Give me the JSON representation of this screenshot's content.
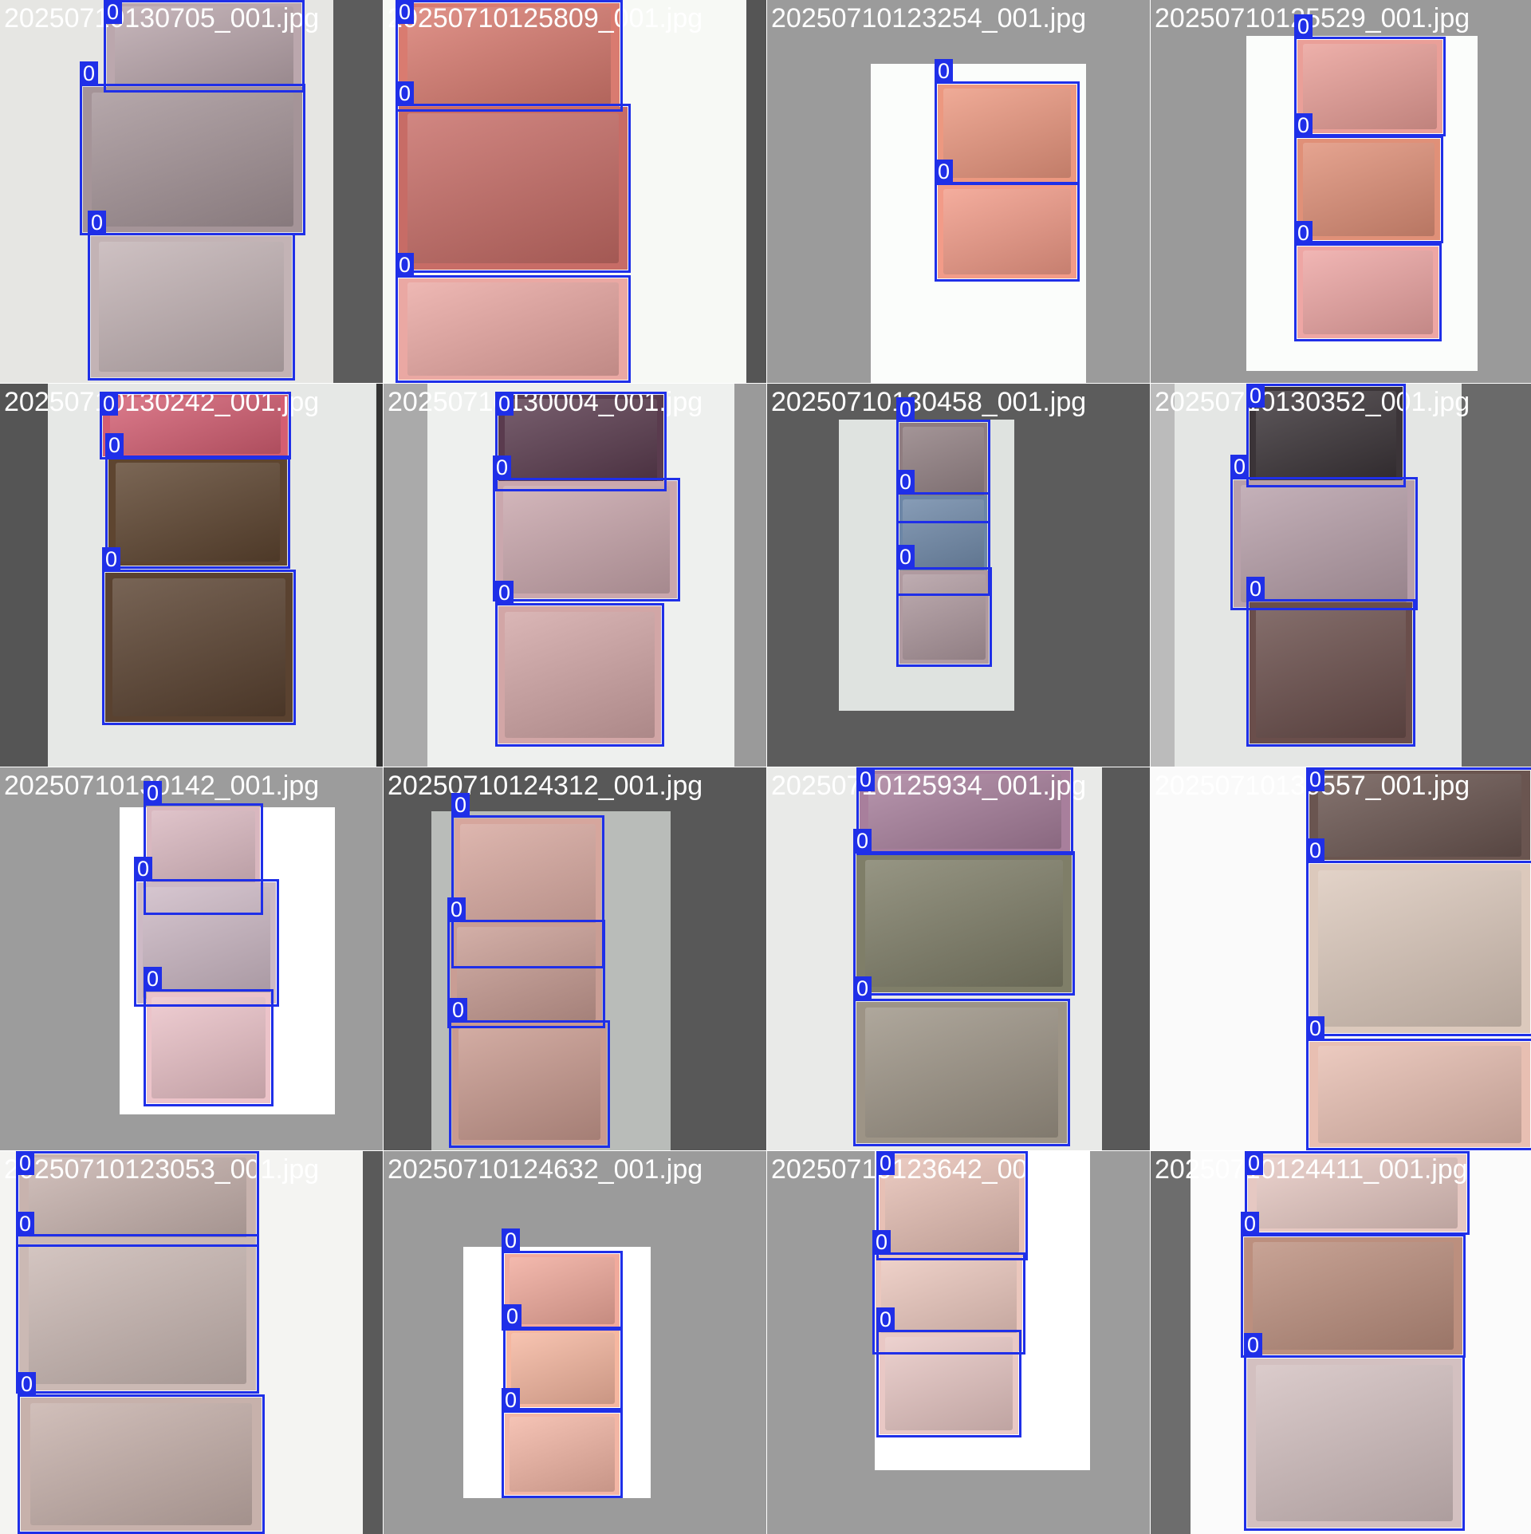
{
  "title": "",
  "box_color": "#1f2fe8",
  "filename_color": "#ffffff",
  "tiles": [
    {
      "filename": "20250710130705_001.jpg",
      "background": "#e6e6e3",
      "detections": [
        {
          "label": "0",
          "photo_color": "#bba7ad"
        },
        {
          "label": "0",
          "photo_color": "#a59498"
        },
        {
          "label": "0",
          "photo_color": "#c3b3b5"
        }
      ]
    },
    {
      "filename": "20250710125809_001.jpg",
      "background": "#f7f9f5",
      "detections": [
        {
          "label": "0",
          "photo_color": "#d97b70"
        },
        {
          "label": "0",
          "photo_color": "#c76c66"
        },
        {
          "label": "0",
          "photo_color": "#eaa8a3"
        }
      ]
    },
    {
      "filename": "20250710123254_001.jpg",
      "background": "#9b9b9b",
      "detections": [
        {
          "label": "0",
          "photo_color": "#ec9880"
        },
        {
          "label": "0",
          "photo_color": "#f29b88"
        }
      ]
    },
    {
      "filename": "20250710125529_001.jpg",
      "background": "#9a9a9a",
      "detections": [
        {
          "label": "0",
          "photo_color": "#ea9f98"
        },
        {
          "label": "0",
          "photo_color": "#e09078"
        },
        {
          "label": "0",
          "photo_color": "#eea6a4"
        }
      ]
    },
    {
      "filename": "20250710130242_001.jpg",
      "background": "#dfe2e0",
      "detections": [
        {
          "label": "0",
          "photo_color": "#d45e72"
        },
        {
          "label": "0",
          "photo_color": "#5e4530"
        },
        {
          "label": "0",
          "photo_color": "#5a4230"
        }
      ]
    },
    {
      "filename": "20250710130004_001.jpg",
      "background": "#e0e2e0",
      "detections": [
        {
          "label": "0",
          "photo_color": "#5a3b4e"
        },
        {
          "label": "0",
          "photo_color": "#caa7ad"
        },
        {
          "label": "0",
          "photo_color": "#d2a6a6"
        }
      ]
    },
    {
      "filename": "20250710130458_001.jpg",
      "background": "#5c5c5c",
      "detections": [
        {
          "label": "0",
          "photo_color": "#8f7d80"
        },
        {
          "label": "0",
          "photo_color": "#6c86a6"
        },
        {
          "label": "0",
          "photo_color": "#b09aa0"
        }
      ]
    },
    {
      "filename": "20250710130352_001.jpg",
      "background": "#5d5d5d",
      "detections": [
        {
          "label": "0",
          "photo_color": "#3b3438"
        },
        {
          "label": "0",
          "photo_color": "#b8a0aa"
        },
        {
          "label": "0",
          "photo_color": "#6a4e4b"
        }
      ]
    },
    {
      "filename": "20250710130142_001.jpg",
      "background": "#9c9c9c",
      "detections": [
        {
          "label": "0",
          "photo_color": "#d9b7bf"
        },
        {
          "label": "0",
          "photo_color": "#cdb9c5"
        },
        {
          "label": "0",
          "photo_color": "#ecc3c9"
        }
      ]
    },
    {
      "filename": "20250710124312_001.jpg",
      "background": "#585858",
      "detections": [
        {
          "label": "0",
          "photo_color": "#d6a69d"
        },
        {
          "label": "0",
          "photo_color": "#c99d94"
        },
        {
          "label": "0",
          "photo_color": "#c99a8f"
        }
      ]
    },
    {
      "filename": "20250710125934_001.jpg",
      "background": "#e7e8e6",
      "detections": [
        {
          "label": "0",
          "photo_color": "#a87f9c"
        },
        {
          "label": "0",
          "photo_color": "#7f7e68"
        },
        {
          "label": "0",
          "photo_color": "#9d9486"
        }
      ]
    },
    {
      "filename": "20250710130557_001.jpg",
      "background": "#fafafa",
      "detections": [
        {
          "label": "0",
          "photo_color": "#6a5550"
        },
        {
          "label": "0",
          "photo_color": "#dcc9bc"
        },
        {
          "label": "0",
          "photo_color": "#e8bfb2"
        }
      ]
    },
    {
      "filename": "20250710123053_001.jpg",
      "background": "#f1f1ef",
      "detections": [
        {
          "label": "0",
          "photo_color": "#c8b3ae"
        },
        {
          "label": "0",
          "photo_color": "#cbb9b4"
        },
        {
          "label": "0",
          "photo_color": "#c7b1ab"
        }
      ]
    },
    {
      "filename": "20250710124632_001.jpg",
      "background": "#9b9b9b",
      "detections": [
        {
          "label": "0",
          "photo_color": "#f1aa9c"
        },
        {
          "label": "0",
          "photo_color": "#f6b7a0"
        },
        {
          "label": "0",
          "photo_color": "#f3b6a5"
        }
      ]
    },
    {
      "filename": "20250710123642_001.jpg",
      "background": "#9c9c9c",
      "detections": [
        {
          "label": "0",
          "photo_color": "#e7c0b5"
        },
        {
          "label": "0",
          "photo_color": "#ebc7bd"
        },
        {
          "label": "0",
          "photo_color": "#e9c8c5"
        }
      ]
    },
    {
      "filename": "20250710124411_001.jpg",
      "background": "#fbfbfb",
      "detections": [
        {
          "label": "0",
          "photo_color": "#e6c8c2"
        },
        {
          "label": "0",
          "photo_color": "#bc8f7e"
        },
        {
          "label": "0",
          "photo_color": "#d3c0c0"
        }
      ]
    }
  ]
}
